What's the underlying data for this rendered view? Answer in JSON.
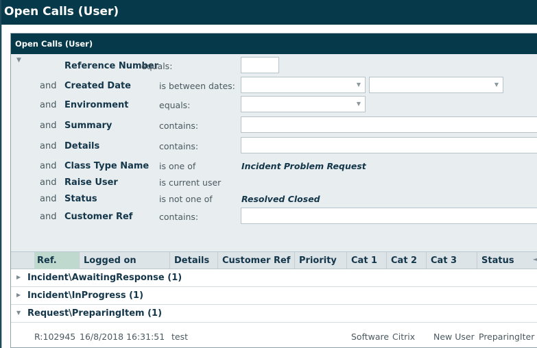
{
  "window": {
    "title": "Open Calls (User)"
  },
  "panel": {
    "title": "Open Calls (User)"
  },
  "filters": [
    {
      "conj": "",
      "field": "Reference Number",
      "op": "equals:",
      "value": ""
    },
    {
      "conj": "and",
      "field": "Created Date",
      "op": "is between dates:",
      "value": ""
    },
    {
      "conj": "and",
      "field": "Environment",
      "op": "equals:",
      "value": ""
    },
    {
      "conj": "and",
      "field": "Summary",
      "op": "contains:",
      "value": ""
    },
    {
      "conj": "and",
      "field": "Details",
      "op": "contains:",
      "value": ""
    },
    {
      "conj": "and",
      "field": "Class Type Name",
      "op": "is one of",
      "value": "Incident Problem Request"
    },
    {
      "conj": "and",
      "field": "Raise User",
      "op": "is current user",
      "value": ""
    },
    {
      "conj": "and",
      "field": "Status",
      "op": "is not one of",
      "value": "Resolved Closed"
    },
    {
      "conj": "and",
      "field": "Customer Ref",
      "op": "contains:",
      "value": ""
    }
  ],
  "grid": {
    "columns": [
      "Ref.",
      "Logged on",
      "Details",
      "Customer Ref",
      "Priority",
      "Cat 1",
      "Cat 2",
      "Cat 3",
      "Status"
    ],
    "groups": [
      {
        "label": "Incident\\AwaitingResponse (1)",
        "expanded": false
      },
      {
        "label": "Incident\\InProgress (1)",
        "expanded": false
      },
      {
        "label": "Request\\PreparingItem (1)",
        "expanded": true
      }
    ],
    "row": {
      "ref": "R:102945",
      "logged_on": "16/8/2018 16:31:51",
      "details": "test",
      "cat1": "Software",
      "cat2": "Citrix",
      "cat3": "New User",
      "status": "PreparingIter"
    }
  },
  "colors": {
    "title_bg": "#063a4a",
    "filter_bg": "#e8edef",
    "sorted_col": "#bfd9cf"
  }
}
